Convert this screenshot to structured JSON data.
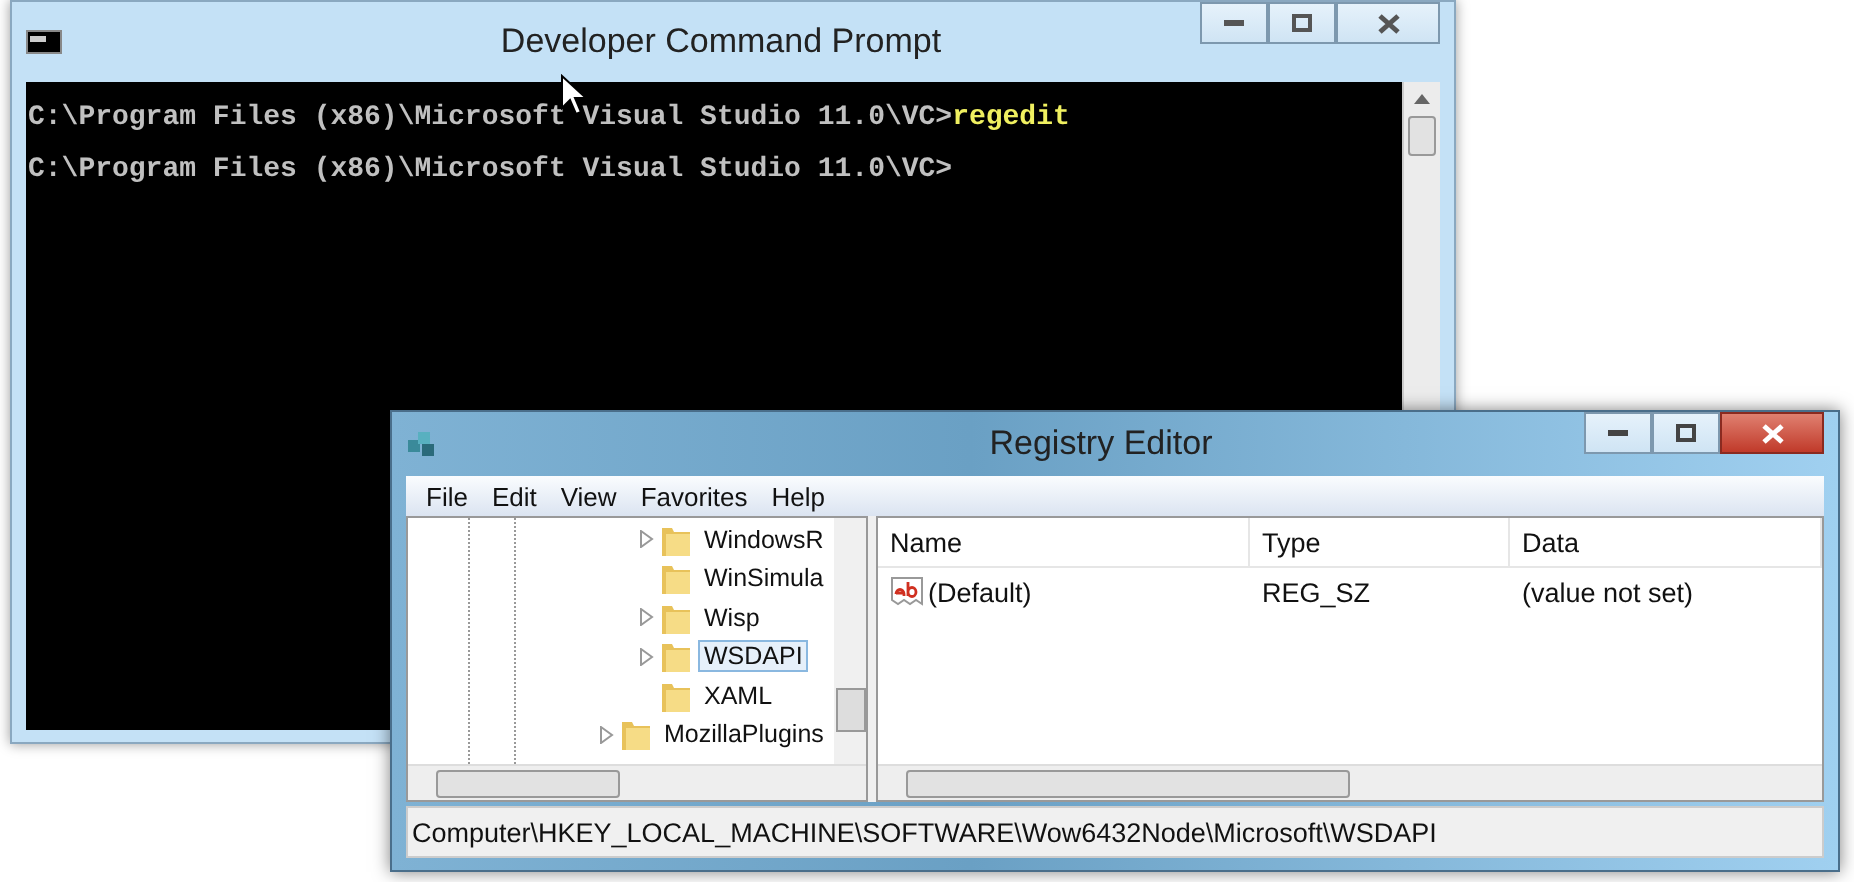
{
  "cmd_window": {
    "title": "Developer Command Prompt",
    "lines": [
      {
        "prompt": "C:\\Program Files (x86)\\Microsoft Visual Studio 11.0\\VC>",
        "command": "regedit"
      },
      {
        "prompt": "C:\\Program Files (x86)\\Microsoft Visual Studio 11.0\\VC>"
      }
    ]
  },
  "registry_window": {
    "title": "Registry Editor",
    "menu": [
      "File",
      "Edit",
      "View",
      "Favorites",
      "Help"
    ],
    "tree": [
      {
        "children": [
          {
            "label": "WindowsR",
            "expandable": true,
            "selected": false
          },
          {
            "label": "WinSimula",
            "expandable": false,
            "selected": false
          },
          {
            "label": "Wisp",
            "expandable": true,
            "selected": false
          },
          {
            "label": "WSDAPI",
            "expandable": true,
            "selected": true
          },
          {
            "label": "XAML",
            "expandable": false,
            "selected": false
          }
        ]
      },
      {
        "label": "MozillaPlugins",
        "expandable": true,
        "selected": false
      }
    ],
    "columns": [
      "Name",
      "Type",
      "Data"
    ],
    "rows": [
      {
        "name": "(Default)",
        "type": "REG_SZ",
        "data": "(value not set)"
      }
    ],
    "status_bar": "Computer\\HKEY_LOCAL_MACHINE\\SOFTWARE\\Wow6432Node\\Microsoft\\WSDAPI"
  }
}
